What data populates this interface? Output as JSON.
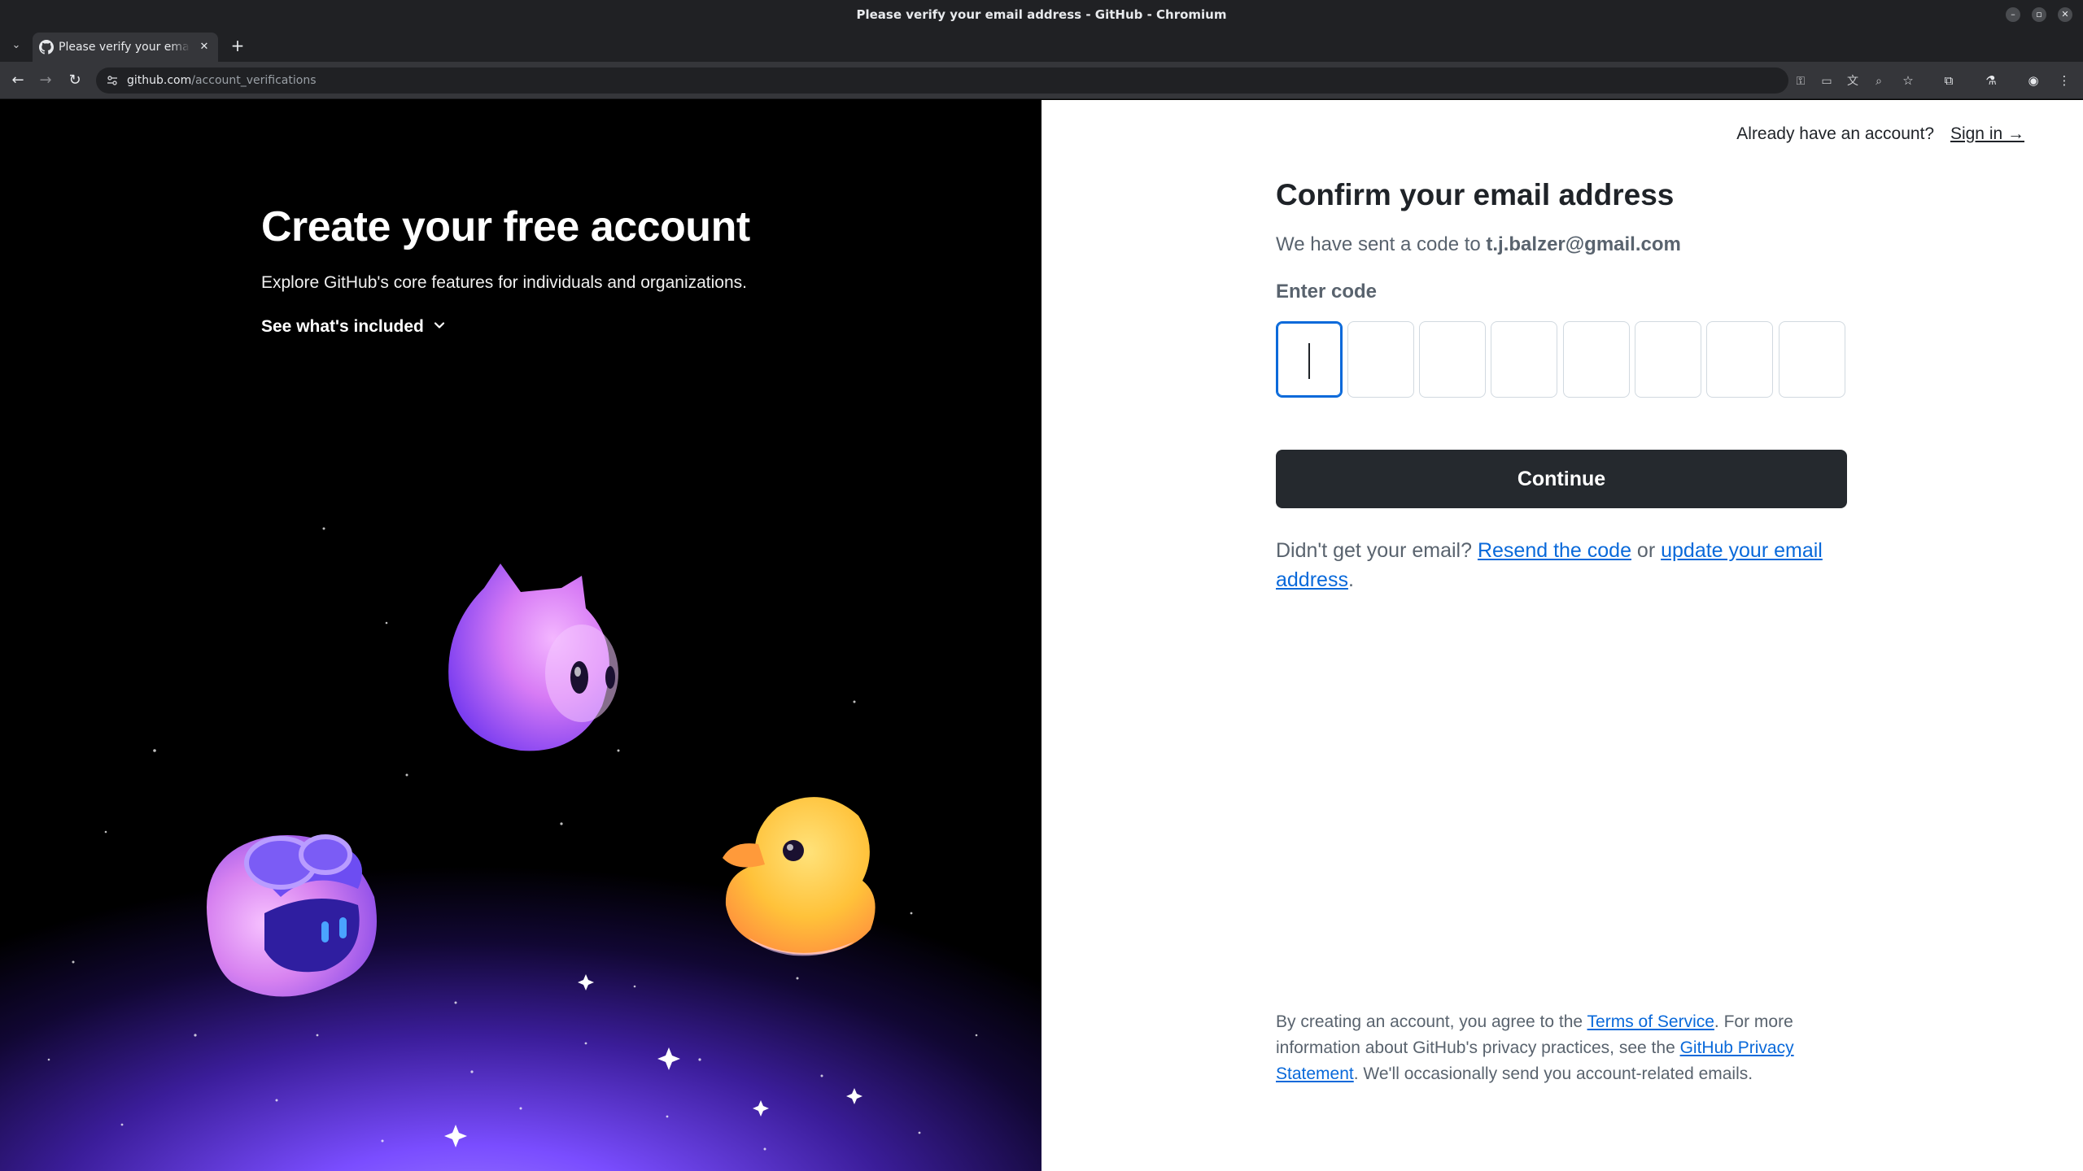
{
  "window": {
    "title": "Please verify your email address - GitHub - Chromium",
    "minimize_icon": "minimize-icon",
    "restore_icon": "restore-icon",
    "close_icon": "close-icon"
  },
  "tabs": [
    {
      "title": "Please verify your email address - GitHub",
      "favicon": "github-icon",
      "active": true
    }
  ],
  "address_bar": {
    "domain": "github.com",
    "path": "/account_verifications"
  },
  "left_panel": {
    "heading": "Create your free account",
    "subtitle": "Explore GitHub's core features for individuals and organizations.",
    "included_label": "See what's included",
    "background_colors": {
      "glow": "#7a4dff",
      "deep": "#110733"
    }
  },
  "right_panel": {
    "already_text": "Already have an account?",
    "sign_in": "Sign in →",
    "heading": "Confirm your email address",
    "sent_prefix": "We have sent a code to ",
    "email": "t.j.balzer@gmail.com",
    "code_label": "Enter code",
    "code_digits": 8,
    "continue_label": "Continue",
    "resend_prefix": "Didn't get your email? ",
    "resend_link": "Resend the code",
    "resend_or": " or ",
    "update_link": "update your email address",
    "resend_suffix": ".",
    "legal": {
      "p1": "By creating an account, you agree to the ",
      "terms_link": "Terms of Service",
      "p2": ". For more information about GitHub's privacy practices, see the ",
      "privacy_link": "GitHub Privacy Statement",
      "p3": ". We'll occasionally send you account-related emails."
    }
  },
  "colors": {
    "link": "#0969da",
    "button": "#25292e",
    "focus_border": "#0969da"
  }
}
